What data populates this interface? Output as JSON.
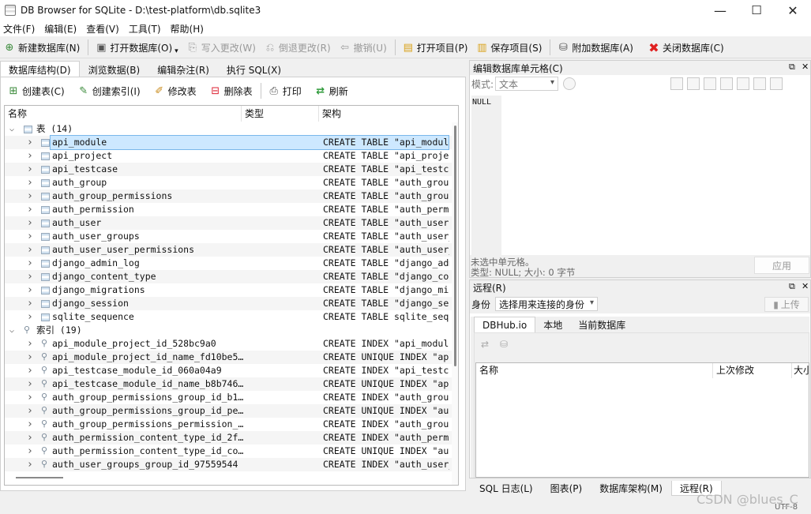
{
  "window": {
    "title": "DB Browser for SQLite - D:\\test-platform\\db.sqlite3",
    "minimize": "—",
    "maximize": "☐",
    "close": "✕"
  },
  "menu": [
    "文件(F)",
    "编辑(E)",
    "查看(V)",
    "工具(T)",
    "帮助(H)"
  ],
  "toolbar": {
    "new_db": "新建数据库(N)",
    "open_db": "打开数据库(O)",
    "write_changes": "写入更改(W)",
    "revert_changes": "倒退更改(R)",
    "undo": "撤销(U)",
    "open_project": "打开项目(P)",
    "save_project": "保存项目(S)",
    "attach_db": "附加数据库(A)",
    "close_db": "关闭数据库(C)"
  },
  "left_tabs": [
    "数据库结构(D)",
    "浏览数据(B)",
    "编辑杂注(R)",
    "执行 SQL(X)"
  ],
  "structure_toolbar": {
    "create_table": "创建表(C)",
    "create_index": "创建索引(I)",
    "modify_table": "修改表",
    "delete_table": "删除表",
    "print": "打印",
    "refresh": "刷新"
  },
  "tree": {
    "columns": [
      "名称",
      "类型",
      "架构"
    ],
    "tables_group": "表 (14)",
    "tables": [
      {
        "name": "api_module",
        "schema": "CREATE TABLE \"api_module"
      },
      {
        "name": "api_project",
        "schema": "CREATE TABLE \"api_project"
      },
      {
        "name": "api_testcase",
        "schema": "CREATE TABLE \"api_testcase"
      },
      {
        "name": "auth_group",
        "schema": "CREATE TABLE \"auth_group"
      },
      {
        "name": "auth_group_permissions",
        "schema": "CREATE TABLE \"auth_group"
      },
      {
        "name": "auth_permission",
        "schema": "CREATE TABLE \"auth_permi"
      },
      {
        "name": "auth_user",
        "schema": "CREATE TABLE \"auth_user\""
      },
      {
        "name": "auth_user_groups",
        "schema": "CREATE TABLE \"auth_user_"
      },
      {
        "name": "auth_user_user_permissions",
        "schema": "CREATE TABLE \"auth_user_"
      },
      {
        "name": "django_admin_log",
        "schema": "CREATE TABLE \"django_adm"
      },
      {
        "name": "django_content_type",
        "schema": "CREATE TABLE \"django_con"
      },
      {
        "name": "django_migrations",
        "schema": "CREATE TABLE \"django_mig"
      },
      {
        "name": "django_session",
        "schema": "CREATE TABLE \"django_ses"
      },
      {
        "name": "sqlite_sequence",
        "schema": "CREATE TABLE sqlite_sequ"
      }
    ],
    "indexes_group": "索引 (19)",
    "indexes": [
      {
        "name": "api_module_project_id_528bc9a0",
        "schema": "CREATE INDEX \"api_module"
      },
      {
        "name": "api_module_project_id_name_fd10be5…",
        "schema": "CREATE UNIQUE INDEX \"api"
      },
      {
        "name": "api_testcase_module_id_060a04a9",
        "schema": "CREATE INDEX \"api_testca"
      },
      {
        "name": "api_testcase_module_id_name_b8b746…",
        "schema": "CREATE UNIQUE INDEX \"api"
      },
      {
        "name": "auth_group_permissions_group_id_b1…",
        "schema": "CREATE INDEX \"auth_group"
      },
      {
        "name": "auth_group_permissions_group_id_pe…",
        "schema": "CREATE UNIQUE INDEX \"aut"
      },
      {
        "name": "auth_group_permissions_permission_…",
        "schema": "CREATE INDEX \"auth_group"
      },
      {
        "name": "auth_permission_content_type_id_2f…",
        "schema": "CREATE INDEX \"auth_permi"
      },
      {
        "name": "auth_permission_content_type_id_co…",
        "schema": "CREATE UNIQUE INDEX \"aut"
      },
      {
        "name": "auth_user_groups_group_id_97559544",
        "schema": "CREATE INDEX \"auth_user_"
      }
    ]
  },
  "cell_editor": {
    "title": "编辑数据库单元格(C)",
    "mode_label": "模式:",
    "mode_value": "文本",
    "content": "NULL",
    "status_line1": "未选中单元格。",
    "status_line2": "类型: NULL; 大小: 0 字节",
    "apply": "应用"
  },
  "remote": {
    "title": "远程(R)",
    "identity_label": "身份",
    "identity_value": "选择用来连接的身份",
    "upload": "上传",
    "tabs": [
      "DBHub.io",
      "本地",
      "当前数据库"
    ],
    "columns": [
      "名称",
      "上次修改",
      "大小"
    ]
  },
  "bottom_tabs": [
    "SQL 日志(L)",
    "图表(P)",
    "数据库架构(M)",
    "远程(R)"
  ],
  "status": {
    "encoding": "UTF-8",
    "watermark": "CSDN @blues_C"
  }
}
